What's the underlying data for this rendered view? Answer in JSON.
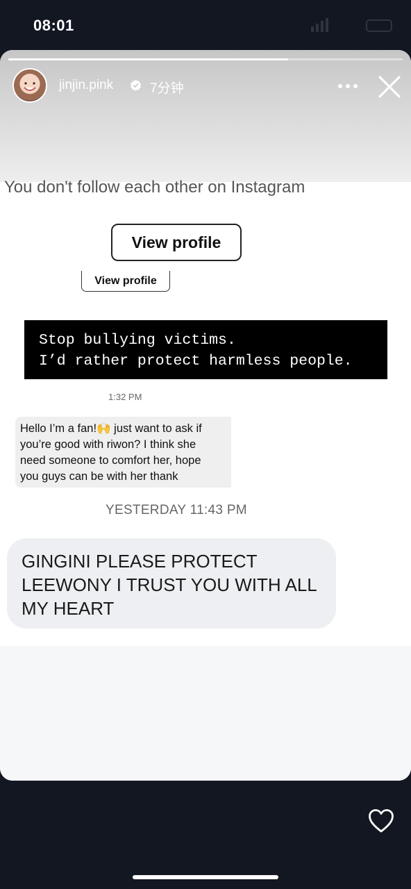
{
  "status_bar": {
    "time": "08:01"
  },
  "story": {
    "progress": 0.71,
    "username": "jinjin.pink",
    "time_ago": "7分钟"
  },
  "screenshot": {
    "follow_text": "You don't follow each other on Instagram",
    "view_profile_large": "View profile",
    "view_profile_small": "View profile",
    "black_box_lines": [
      "Stop bullying victims.",
      "I’d rather protect harmless people."
    ],
    "timestamp_1": "1:32 PM",
    "fan_message_lines": [
      "Hello I’m a fan!🙌 just want to ask if",
      "you’re good with riwon? I think she",
      "need someone to comfort her, hope",
      "you guys can be with her thank"
    ],
    "timestamp_2": "YESTERDAY 11:43 PM",
    "plea_lines": [
      "GINGINI PLEASE PROTECT",
      "LEEWONY I TRUST YOU WITH ALL",
      "MY HEART"
    ]
  },
  "icons": {
    "verified": "verified-badge-icon",
    "more": "more-options-icon",
    "close": "close-icon",
    "like": "heart-icon"
  },
  "colors": {
    "background": "#131722",
    "card": "#ffffff",
    "bubble": "#eeeff3"
  }
}
